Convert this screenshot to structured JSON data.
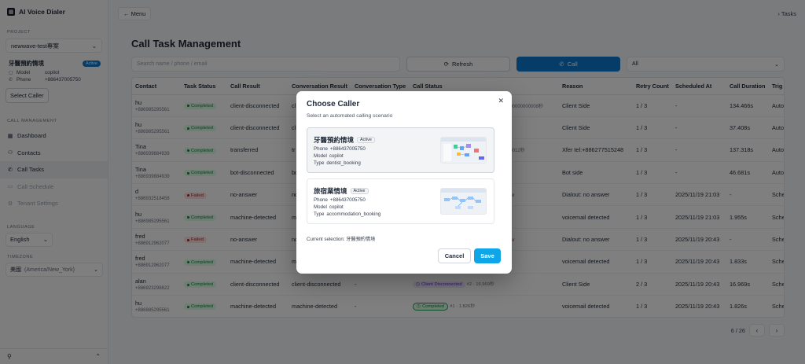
{
  "app": {
    "title": "AI Voice Dialer"
  },
  "sidebar": {
    "project_label": "PROJECT",
    "project_value": "newwave-test專案",
    "caller": {
      "name": "牙醫預約情境",
      "badge": "Active",
      "model_label": "Model",
      "model_value": "copilot",
      "phone_label": "Phone",
      "phone_value": "+886437005750"
    },
    "select_caller": "Select Caller",
    "call_mgmt_label": "CALL MANAGEMENT",
    "nav": [
      {
        "label": "Dashboard",
        "icon": "grid-icon"
      },
      {
        "label": "Contacts",
        "icon": "users-icon"
      },
      {
        "label": "Call Tasks",
        "icon": "phone-icon"
      },
      {
        "label": "Call Schedule",
        "icon": "calendar-icon"
      },
      {
        "label": "Tenant Settings",
        "icon": "gear-icon"
      }
    ],
    "language_label": "LANGUAGE",
    "language_value": "English",
    "timezone_label": "TIMEZONE",
    "timezone_value": "美國",
    "timezone_code": "(America/New_York)"
  },
  "topbar": {
    "menu": "Menu",
    "crumb": "Tasks"
  },
  "main": {
    "title": "Call Task Management",
    "search_placeholder": "Search name / phone / email",
    "refresh": "Refresh",
    "call": "Call",
    "filter": "All"
  },
  "table": {
    "columns": [
      "Contact",
      "Task Status",
      "Call Result",
      "Conversation Result",
      "Conversation Type",
      "Call Status",
      "",
      "Reason",
      "Retry Count",
      "Scheduled At",
      "Call Duration",
      "Trig"
    ],
    "rows": [
      {
        "name": "hu",
        "phone": "+886985295561",
        "status": "Completed",
        "result": "client-disconnected",
        "conv": "cl",
        "type": "",
        "cs": "",
        "cs_note": "",
        "cs_tail": "000000000008秒",
        "reason": "Client Side",
        "retry": "1 / 3",
        "sched": "-",
        "dur": "134.466s",
        "trig": "Auto"
      },
      {
        "name": "hu",
        "phone": "+886985295561",
        "status": "Completed",
        "result": "client-disconnected",
        "conv": "cl",
        "type": "",
        "cs": "",
        "cs_note": "",
        "cs_tail": "",
        "reason": "Client Side",
        "retry": "1 / 3",
        "sched": "-",
        "dur": "37.408s",
        "trig": "Auto"
      },
      {
        "name": "Tina",
        "phone": "+886939884939",
        "status": "Completed",
        "result": "transferred",
        "conv": "tr",
        "type": "",
        "cs": "",
        "cs_note": "",
        "cs_tail": "00012秒",
        "reason": "Xfer tel:+886277515248",
        "retry": "1 / 3",
        "sched": "-",
        "dur": "137.318s",
        "trig": "Auto"
      },
      {
        "name": "Tina",
        "phone": "+886939884939",
        "status": "Completed",
        "result": "bot-disconnected",
        "conv": "bo",
        "type": "",
        "cs": "",
        "cs_note": "",
        "cs_tail": "",
        "reason": "Bot side",
        "retry": "1 / 3",
        "sched": "-",
        "dur": "46.681s",
        "trig": "Auto"
      },
      {
        "name": "d",
        "phone": "+886932518458",
        "status": "Failed",
        "result": "no-answer",
        "conv": "no",
        "type": "",
        "cs": "",
        "cs_note": "",
        "cs_tail": "wer",
        "reason": "Dialout: no answer",
        "retry": "1 / 3",
        "sched": "2025/11/19 21:03",
        "dur": "-",
        "trig": "Sche"
      },
      {
        "name": "hu",
        "phone": "+886985295561",
        "status": "Completed",
        "result": "machine-detected",
        "conv": "m",
        "type": "",
        "cs": "",
        "cs_note": "",
        "cs_tail": "",
        "reason": "voicemail detected",
        "retry": "1 / 3",
        "sched": "2025/11/19 21:03",
        "dur": "1.955s",
        "trig": "Sche"
      },
      {
        "name": "fred",
        "phone": "+886912962077",
        "status": "Failed",
        "result": "no-answer",
        "conv": "no",
        "type": "",
        "cs": "",
        "cs_note": "",
        "cs_tail": "wer",
        "reason": "Dialout: no answer",
        "retry": "1 / 3",
        "sched": "2025/11/19 20:43",
        "dur": "-",
        "trig": "Sche"
      },
      {
        "name": "fred",
        "phone": "+886912962077",
        "status": "Completed",
        "result": "machine-detected",
        "conv": "m",
        "type": "",
        "cs": "",
        "cs_note": "",
        "cs_tail": "",
        "reason": "voicemail detected",
        "retry": "1 / 3",
        "sched": "2025/11/19 20:43",
        "dur": "1.833s",
        "trig": "Sche"
      },
      {
        "name": "alan",
        "phone": "+886923298822",
        "status": "Completed",
        "result": "client-disconnected",
        "conv": "client-disconnected",
        "type": "-",
        "cs": "Client Disconnected",
        "cs_note": "#2 · 16.969秒",
        "cs_tail": "",
        "reason": "Client Side",
        "retry": "2 / 3",
        "sched": "2025/11/19 20:43",
        "dur": "16.969s",
        "trig": "Sche"
      },
      {
        "name": "hu",
        "phone": "+886985295561",
        "status": "Completed",
        "result": "machine-detected",
        "conv": "machine-detected",
        "type": "-",
        "cs": "Completed",
        "cs_note": "#1 · 1.826秒",
        "cs_tail": "",
        "reason": "voicemail detected",
        "retry": "1 / 3",
        "sched": "2025/11/19 20:43",
        "dur": "1.826s",
        "trig": "Sche"
      }
    ]
  },
  "pager": {
    "text": "6 / 26"
  },
  "modal": {
    "title": "Choose Caller",
    "subtitle": "Select an automated calling scenario",
    "options": [
      {
        "name": "牙醫預約情境",
        "badge": "Active",
        "phone_label": "Phone",
        "phone": "+886437005750",
        "model_label": "Model",
        "model": "copilot",
        "type_label": "Type",
        "type": "dentist_booking"
      },
      {
        "name": "旅宿業情境",
        "badge": "Active",
        "phone_label": "Phone",
        "phone": "+886437005750",
        "model_label": "Model",
        "model": "copilot",
        "type_label": "Type",
        "type": "accommodation_booking"
      }
    ],
    "current_selection": "Current selection: 牙醫預約情境",
    "cancel": "Cancel",
    "save": "Save"
  },
  "colors": {
    "accent": "#0b78d1",
    "save": "#0ea5e9",
    "completed": "#15803d",
    "failed": "#b91c1c"
  }
}
